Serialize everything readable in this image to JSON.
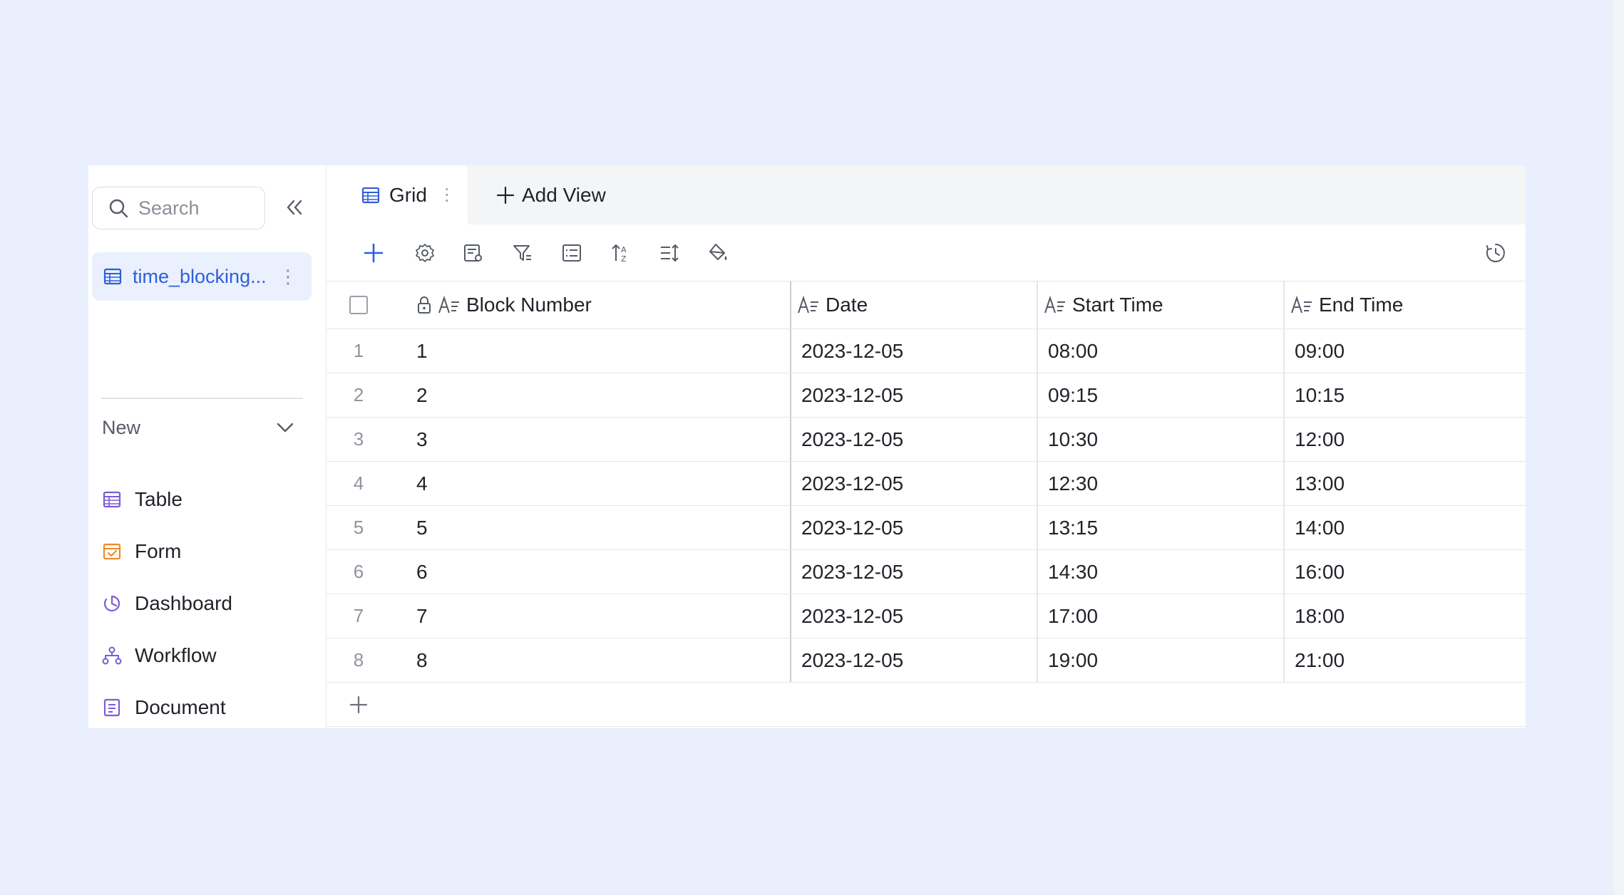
{
  "sidebar": {
    "search_placeholder": "Search",
    "table_name": "time_blocking...",
    "new_label": "New",
    "new_items": [
      {
        "label": "Table",
        "icon": "table-icon",
        "color": "#7b5cd6"
      },
      {
        "label": "Form",
        "icon": "form-icon",
        "color": "#f08a24"
      },
      {
        "label": "Dashboard",
        "icon": "dashboard-icon",
        "color": "#7b5cd6"
      },
      {
        "label": "Workflow",
        "icon": "workflow-icon",
        "color": "#7b5cd6"
      },
      {
        "label": "Document",
        "icon": "document-icon",
        "color": "#7b5cd6"
      }
    ]
  },
  "tabs": {
    "active_label": "Grid",
    "add_view_label": "Add View"
  },
  "toolbar": {
    "icons": [
      "add-record-icon",
      "settings-icon",
      "field-config-icon",
      "filter-icon",
      "group-icon",
      "sort-icon",
      "row-height-icon",
      "fill-color-icon",
      "history-icon"
    ]
  },
  "grid": {
    "columns": [
      "Block Number",
      "Date",
      "Start Time",
      "End Time"
    ],
    "rows": [
      {
        "index": "1",
        "block": "1",
        "date": "2023-12-05",
        "start": "08:00",
        "end": "09:00"
      },
      {
        "index": "2",
        "block": "2",
        "date": "2023-12-05",
        "start": "09:15",
        "end": "10:15"
      },
      {
        "index": "3",
        "block": "3",
        "date": "2023-12-05",
        "start": "10:30",
        "end": "12:00"
      },
      {
        "index": "4",
        "block": "4",
        "date": "2023-12-05",
        "start": "12:30",
        "end": "13:00"
      },
      {
        "index": "5",
        "block": "5",
        "date": "2023-12-05",
        "start": "13:15",
        "end": "14:00"
      },
      {
        "index": "6",
        "block": "6",
        "date": "2023-12-05",
        "start": "14:30",
        "end": "16:00"
      },
      {
        "index": "7",
        "block": "7",
        "date": "2023-12-05",
        "start": "17:00",
        "end": "18:00"
      },
      {
        "index": "8",
        "block": "8",
        "date": "2023-12-05",
        "start": "19:00",
        "end": "21:00"
      }
    ]
  },
  "colors": {
    "accent": "#2f5fd9",
    "page_bg": "#e9effc",
    "selected_bg": "#eaf0fd"
  }
}
